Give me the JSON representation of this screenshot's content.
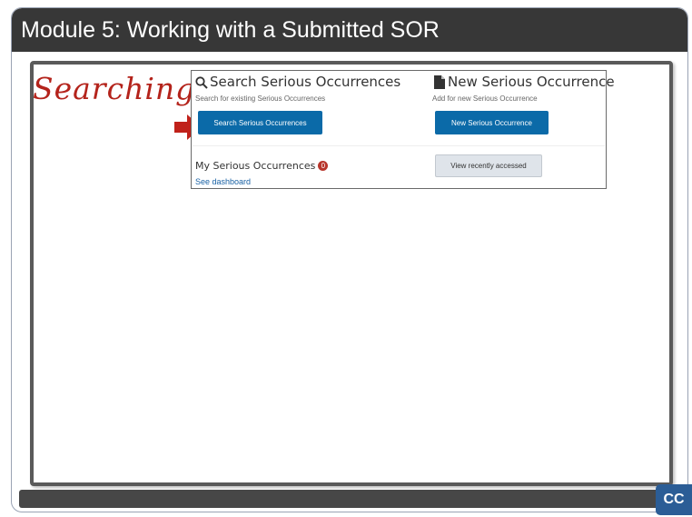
{
  "slide": {
    "title": "Module 5:  Working with a Submitted SOR",
    "annotation": "Searching"
  },
  "panel": {
    "search": {
      "title": "Search Serious Occurrences",
      "subtitle": "Search for existing Serious Occurrences",
      "button_label": "Search Serious Occurrences",
      "icon": "search-icon"
    },
    "new": {
      "title": "New Serious Occurrence",
      "subtitle": "Add for new Serious Occurrence",
      "button_label": "New Serious Occurrence",
      "icon": "document-icon"
    },
    "mine": {
      "title": "My Serious Occurrences",
      "badge": "0",
      "link": "See dashboard"
    },
    "recent_button_label": "View recently accessed"
  },
  "player": {
    "cc_label": "CC"
  },
  "colors": {
    "title_bar": "#373737",
    "primary_button": "#0b6aa8",
    "annotation": "#b4231b",
    "arrow": "#c0211a",
    "cc_button": "#2b5d96"
  }
}
